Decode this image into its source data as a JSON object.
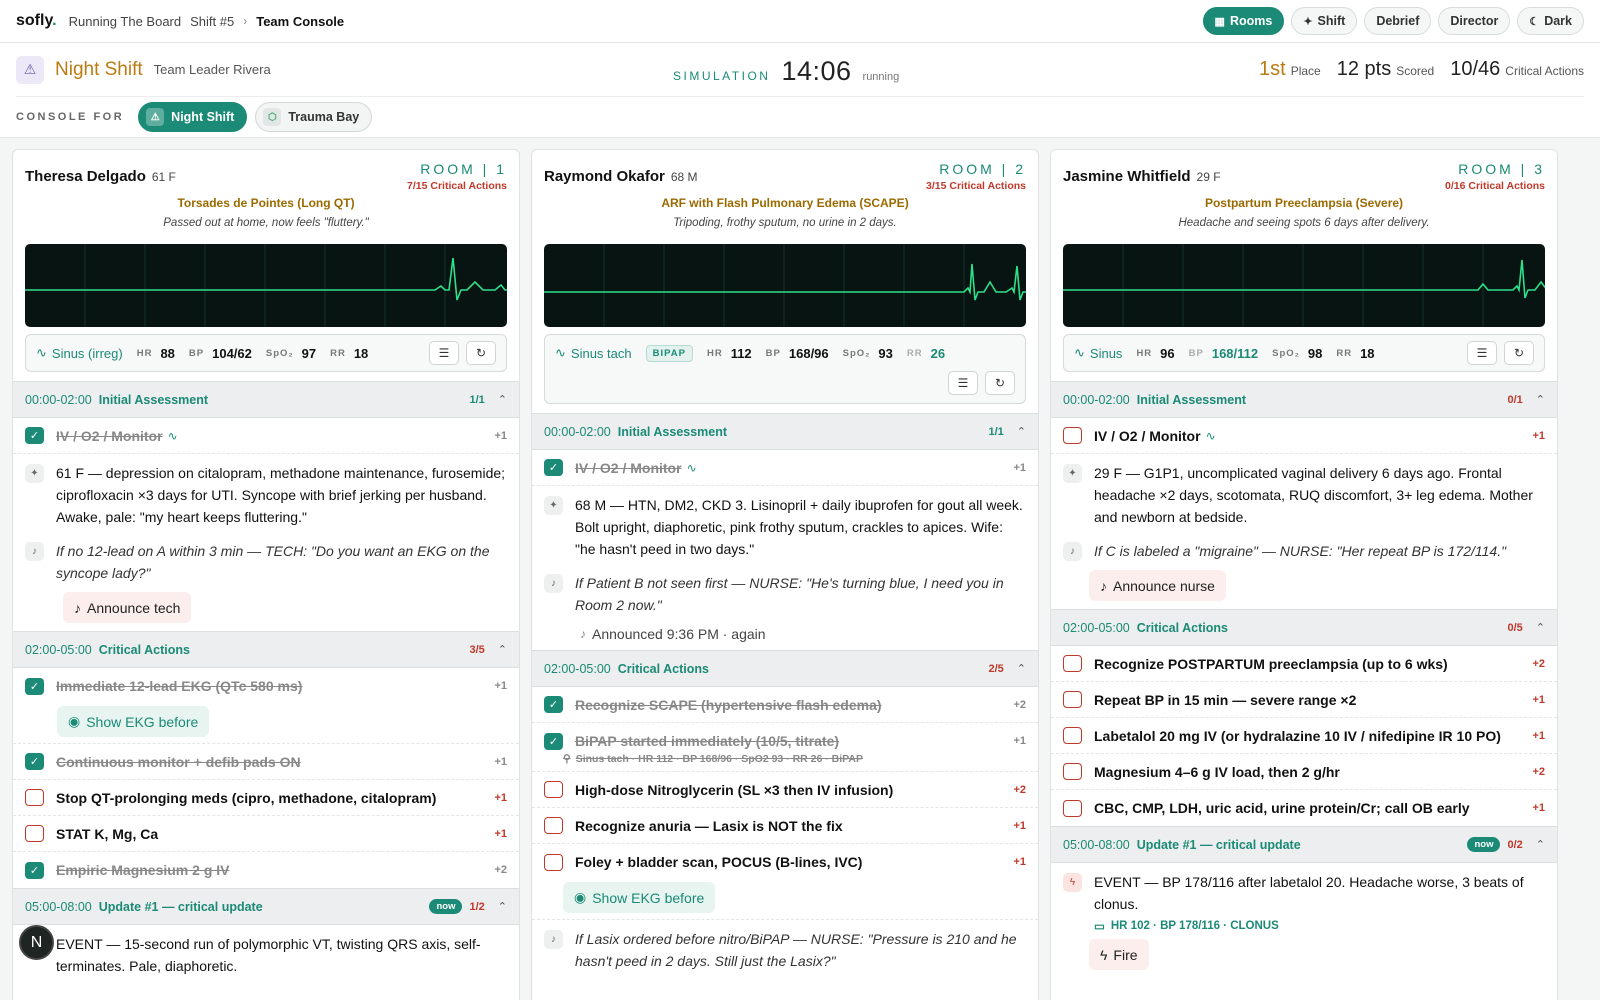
{
  "topbar": {
    "logo": "sofly",
    "logo_dot": ".",
    "crumbs": [
      "Running The Board",
      "Shift #5",
      "Team Console"
    ],
    "crumb_sep": "›",
    "nav": [
      {
        "label": "Rooms",
        "icon": "grid-icon"
      },
      {
        "label": "Shift",
        "icon": "sparkle-icon"
      },
      {
        "label": "Debrief"
      },
      {
        "label": "Director"
      },
      {
        "label": "Dark",
        "icon": "moon-icon"
      }
    ]
  },
  "header": {
    "shift_name": "Night Shift",
    "leader": "Team Leader Rivera",
    "sim_label": "SIMULATION",
    "sim_time": "14:06",
    "sim_state": "running",
    "stats": [
      {
        "value": "1st",
        "label": "Place"
      },
      {
        "value": "12 pts",
        "label": "Scored"
      },
      {
        "value": "10/46",
        "label": "Critical Actions"
      }
    ],
    "console_for_label": "CONSOLE FOR",
    "console_pills": [
      "Night Shift",
      "Trauma Bay"
    ]
  },
  "rooms": [
    {
      "patient": "Theresa Delgado",
      "age": "61 F",
      "room": "ROOM | 1",
      "crit": "7/15 Critical Actions",
      "dx": "Torsades de Pointes (Long QT)",
      "cc": "Passed out at home, now feels \"fluttery.\"",
      "vitals": {
        "rhythm": "Sinus (irreg)",
        "hr_k": "HR",
        "hr": "88",
        "bp_k": "BP",
        "bp": "104/62",
        "spo2_k": "SpO₂",
        "spo2": "97",
        "rr_k": "RR",
        "rr": "18"
      },
      "sec1": {
        "time": "00:00-02:00",
        "title": "Initial Assessment",
        "count": "1/1"
      },
      "sec1_item": {
        "text": "IV / O2 / Monitor",
        "pts": "+1"
      },
      "sec1_note": "61 F — depression on citalopram, methadone maintenance, furosemide; ciprofloxacin ×3 days for UTI. Syncope with brief jerking per husband. Awake, pale: \"my heart keeps fluttering.\"",
      "sec1_trigger": "If no 12-lead on A within 3 min — TECH: \"Do you want an EKG on the syncope lady?\"",
      "sec1_button": "Announce tech",
      "sec2": {
        "time": "02:00-05:00",
        "title": "Critical Actions",
        "count": "3/5"
      },
      "sec2_items": [
        {
          "text": "Immediate 12-lead EKG (QTc 580 ms)",
          "pts": "+1"
        },
        {
          "text": "Continuous monitor + defib pads ON",
          "pts": "+1"
        },
        {
          "text": "Stop QT-prolonging meds (cipro, methadone, citalopram)",
          "pts": "+1"
        },
        {
          "text": "STAT K, Mg, Ca",
          "pts": "+1"
        },
        {
          "text": "Empiric Magnesium 2 g IV",
          "pts": "+2"
        }
      ],
      "show_ekg": "Show EKG before",
      "sec3": {
        "time": "05:00-08:00",
        "title": "Update #1 — critical update",
        "now": "now",
        "count": "1/2"
      },
      "sec3_note": "EVENT — 15-second run of polymorphic VT, twisting QRS axis, self-terminates. Pale, diaphoretic."
    },
    {
      "patient": "Raymond Okafor",
      "age": "68 M",
      "room": "ROOM | 2",
      "crit": "3/15 Critical Actions",
      "dx": "ARF with Flash Pulmonary Edema (SCAPE)",
      "cc": "Tripoding, frothy sputum, no urine in 2 days.",
      "vitals": {
        "rhythm": "Sinus tach",
        "mode": "BIPAP",
        "hr_k": "HR",
        "hr": "112",
        "bp_k": "BP",
        "bp": "168/96",
        "spo2_k": "SpO₂",
        "spo2": "93",
        "rr_k": "RR",
        "rr": "26"
      },
      "sec1": {
        "time": "00:00-02:00",
        "title": "Initial Assessment",
        "count": "1/1"
      },
      "sec1_item": {
        "text": "IV / O2 / Monitor",
        "pts": "+1"
      },
      "sec1_note": "68 M — HTN, DM2, CKD 3. Lisinopril + daily ibuprofen for gout all week. Bolt upright, diaphoretic, pink frothy sputum, crackles to apices. Wife: \"he hasn't peed in two days.\"",
      "sec1_trigger": "If Patient B not seen first — NURSE: \"He's turning blue, I need you in Room 2 now.\"",
      "announced": "Announced 9:36 PM · again",
      "sec2": {
        "time": "02:00-05:00",
        "title": "Critical Actions",
        "count": "2/5"
      },
      "sec2_items": [
        {
          "text": "Recognize SCAPE (hypertensive flash edema)",
          "pts": "+2"
        },
        {
          "text": "BiPAP started immediately (10/5, titrate)",
          "pts": "+1",
          "sub": "Sinus tach · HR 112 · BP 168/96 · SpO2 93 · RR 26 · BiPAP"
        },
        {
          "text": "High-dose Nitroglycerin (SL ×3 then IV infusion)",
          "pts": "+2"
        },
        {
          "text": "Recognize anuria — Lasix is NOT the fix",
          "pts": "+1"
        },
        {
          "text": "Foley + bladder scan, POCUS (B-lines, IVC)",
          "pts": "+1"
        }
      ],
      "show_ekg": "Show EKG before",
      "sec2_trigger": "If Lasix ordered before nitro/BiPAP — NURSE: \"Pressure is 210 and he hasn't peed in 2 days. Still just the Lasix?\""
    },
    {
      "patient": "Jasmine Whitfield",
      "age": "29 F",
      "room": "ROOM | 3",
      "crit": "0/16 Critical Actions",
      "dx": "Postpartum Preeclampsia (Severe)",
      "cc": "Headache and seeing spots 6 days after delivery.",
      "vitals": {
        "rhythm": "Sinus",
        "hr_k": "HR",
        "hr": "96",
        "bp_k": "BP",
        "bp": "168/112",
        "spo2_k": "SpO₂",
        "spo2": "98",
        "rr_k": "RR",
        "rr": "18"
      },
      "sec1": {
        "time": "00:00-02:00",
        "title": "Initial Assessment",
        "count": "0/1"
      },
      "sec1_item": {
        "text": "IV / O2 / Monitor",
        "pts": "+1"
      },
      "sec1_note": "29 F — G1P1, uncomplicated vaginal delivery 6 days ago. Frontal headache ×2 days, scotomata, RUQ discomfort, 3+ leg edema. Mother and newborn at bedside.",
      "sec1_trigger": "If C is labeled a \"migraine\" — NURSE: \"Her repeat BP is 172/114.\"",
      "sec1_button": "Announce nurse",
      "sec2": {
        "time": "02:00-05:00",
        "title": "Critical Actions",
        "count": "0/5"
      },
      "sec2_items": [
        {
          "text": "Recognize POSTPARTUM preeclampsia (up to 6 wks)",
          "pts": "+2"
        },
        {
          "text": "Repeat BP in 15 min — severe range ×2",
          "pts": "+1"
        },
        {
          "text": "Labetalol 20 mg IV (or hydralazine 10 IV / nifedipine IR 10 PO)",
          "pts": "+1"
        },
        {
          "text": "Magnesium 4–6 g IV load, then 2 g/hr",
          "pts": "+2"
        },
        {
          "text": "CBC, CMP, LDH, uric acid, urine protein/Cr; call OB early",
          "pts": "+1"
        }
      ],
      "sec3": {
        "time": "05:00-08:00",
        "title": "Update #1 — critical update",
        "now": "now",
        "count": "0/2"
      },
      "sec3_note": "EVENT — BP 178/116 after labetalol 20. Headache worse, 3 beats of clonus.",
      "sec3_sub": "HR 102 · BP 178/116 · CLONUS",
      "sec3_button": "Fire"
    }
  ],
  "fab": "N"
}
